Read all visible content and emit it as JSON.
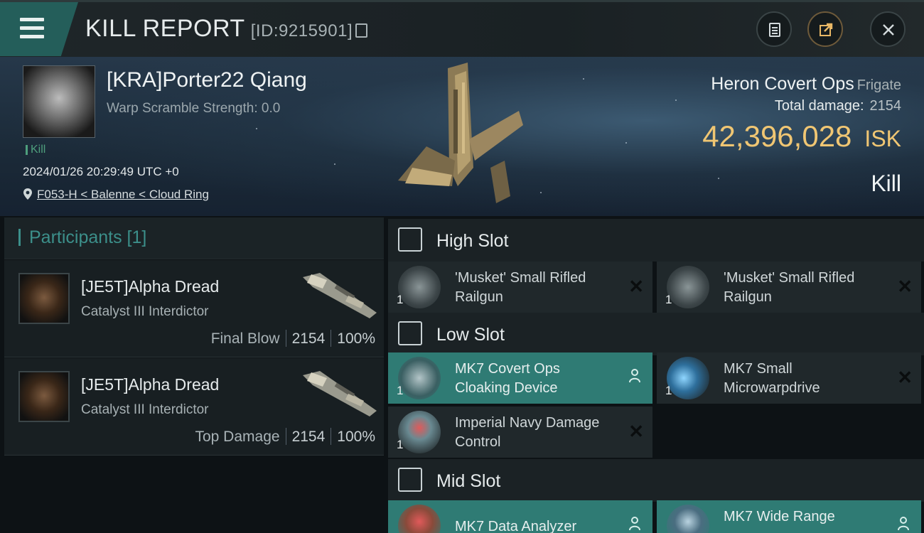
{
  "header": {
    "title": "KILL REPORT",
    "report_id": "[ID:9215901]"
  },
  "victim": {
    "name": "[KRA]Porter22 Qiang",
    "warp_scramble": "Warp Scramble Strength: 0.0",
    "kill_tag": "Kill",
    "datetime": "2024/01/26 20:29:49 UTC +0",
    "location": "F053-H < Balenne < Cloud Ring",
    "ship_name": "Heron Covert Ops",
    "ship_class": "Frigate",
    "total_damage_label": "Total damage:",
    "total_damage_value": "2154",
    "isk_value": "42,396,028",
    "isk_unit": "ISK",
    "result": "Kill"
  },
  "participants": {
    "header": "Participants [1]",
    "rows": [
      {
        "name": "[JE5T]Alpha Dread",
        "ship": "Catalyst III Interdictor",
        "role": "Final Blow",
        "damage": "2154",
        "percent": "100%"
      },
      {
        "name": "[JE5T]Alpha Dread",
        "ship": "Catalyst III Interdictor",
        "role": "Top Damage",
        "damage": "2154",
        "percent": "100%"
      }
    ]
  },
  "slots": {
    "high": {
      "label": "High Slot",
      "modules": [
        {
          "qty": "1",
          "name": "'Musket' Small Rifled Railgun"
        },
        {
          "qty": "1",
          "name": "'Musket' Small Rifled Railgun"
        }
      ]
    },
    "low": {
      "label": "Low Slot",
      "modules": [
        {
          "qty": "1",
          "name": "MK7 Covert Ops Cloaking Device"
        },
        {
          "qty": "1",
          "name": "MK7 Small Microwarpdrive"
        },
        {
          "qty": "1",
          "name": "Imperial Navy Damage Control"
        }
      ]
    },
    "mid": {
      "label": "Mid Slot",
      "modules": [
        {
          "qty": "",
          "name": "MK7 Data Analyzer"
        },
        {
          "qty": "",
          "name": "MK7 Wide Range"
        }
      ]
    }
  },
  "colors": {
    "accent_teal": "#2f7b74",
    "isk_gold": "#f0c673",
    "kill_green": "#4e9f7d"
  },
  "icons": [
    "menu-icon",
    "copy-icon",
    "clipboard-icon",
    "share-icon",
    "close-icon",
    "location-pin-icon",
    "slot-icon",
    "destroyed-x-icon",
    "dropped-person-icon"
  ]
}
